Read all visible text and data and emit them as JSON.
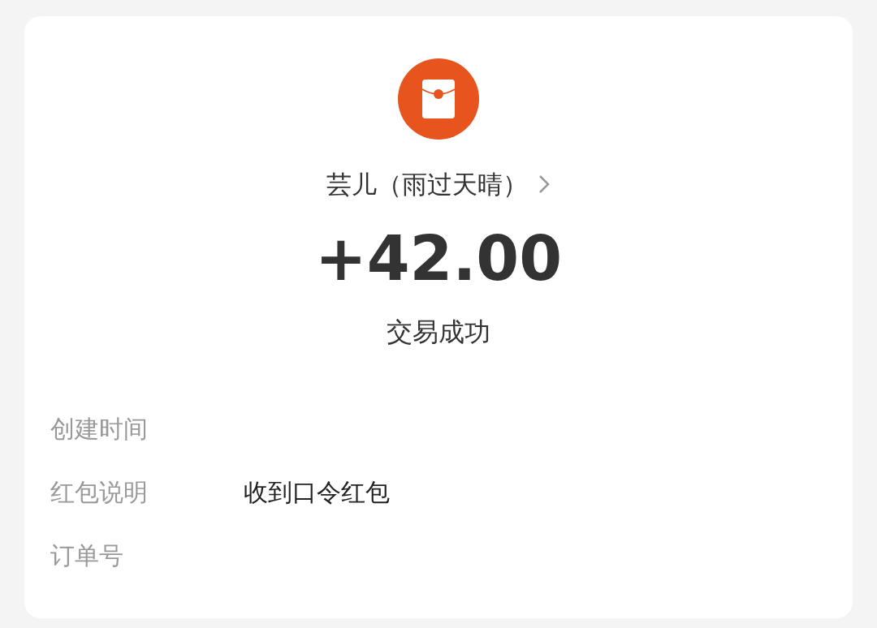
{
  "payer": {
    "name": "芸儿（雨过天晴）"
  },
  "amount": "+42.00",
  "status": "交易成功",
  "details": [
    {
      "label": "创建时间"
    },
    {
      "label": "红包说明",
      "value": "收到口令红包"
    },
    {
      "label": "订单号"
    }
  ]
}
